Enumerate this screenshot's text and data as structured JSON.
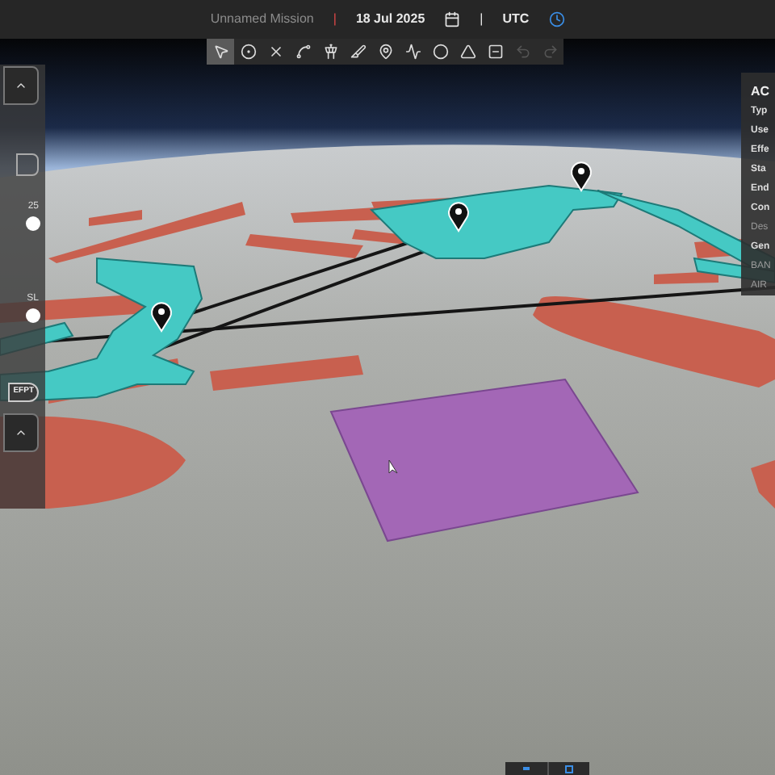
{
  "header": {
    "mission": "Unnamed Mission",
    "separator": "|",
    "date": "18 Jul 2025",
    "separator_2": "|",
    "timezone": "UTC"
  },
  "toolbar": {
    "tools": [
      {
        "selected": true,
        "disabled": false
      },
      {
        "selected": false,
        "disabled": false
      },
      {
        "selected": false,
        "disabled": false
      },
      {
        "selected": false,
        "disabled": false
      },
      {
        "selected": false,
        "disabled": false
      },
      {
        "selected": false,
        "disabled": false
      },
      {
        "selected": false,
        "disabled": false
      },
      {
        "selected": false,
        "disabled": false
      },
      {
        "selected": false,
        "disabled": false
      },
      {
        "selected": false,
        "disabled": false
      },
      {
        "selected": false,
        "disabled": false
      },
      {
        "selected": false,
        "disabled": true
      },
      {
        "selected": false,
        "disabled": true
      }
    ]
  },
  "left_panel": {
    "slider_1_label": "25",
    "slider_2_label": "SL",
    "chip": "EFPT"
  },
  "right_panel": {
    "title": "AC",
    "rows": [
      {
        "text": "Typ",
        "kind": "label"
      },
      {
        "text": "Use",
        "kind": "label"
      },
      {
        "text": "Effe",
        "kind": "label"
      },
      {
        "text": "Sta",
        "kind": "label"
      },
      {
        "text": "End",
        "kind": "label"
      },
      {
        "text": "Con",
        "kind": "label"
      },
      {
        "text": "Des",
        "kind": "value"
      },
      {
        "text": "Gen",
        "kind": "label"
      },
      {
        "text": "BAN",
        "kind": "value"
      },
      {
        "text": "AIR",
        "kind": "value"
      }
    ]
  }
}
